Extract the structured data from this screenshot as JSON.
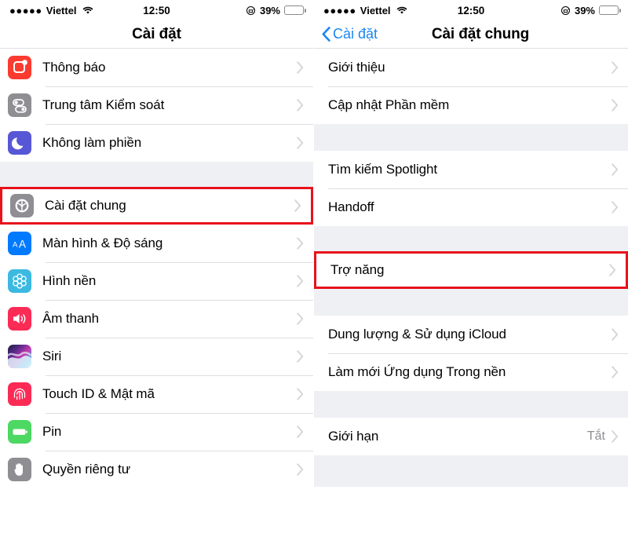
{
  "status_bar": {
    "signal_dots": "●●●●●",
    "carrier": "Viettel",
    "wifi_icon": "wifi-icon",
    "time": "12:50",
    "lock_icon": "rotation-lock-icon",
    "battery_percent": "39%",
    "battery_level": 39,
    "battery_color": "#ffcc00"
  },
  "left_screen": {
    "nav": {
      "title": "Cài đặt"
    },
    "groups": [
      {
        "rows": [
          {
            "label": "Thông báo",
            "icon": "notifications-icon",
            "icon_class": "ic-notify",
            "chevron": true
          },
          {
            "label": "Trung tâm Kiểm soát",
            "icon": "control-center-icon",
            "icon_class": "ic-control",
            "chevron": true
          },
          {
            "label": "Không làm phiền",
            "icon": "do-not-disturb-moon-icon",
            "icon_class": "ic-dnd",
            "chevron": true
          }
        ]
      },
      {
        "rows": [
          {
            "label": "Cài đặt chung",
            "icon": "gear-icon",
            "icon_class": "ic-general",
            "chevron": true,
            "highlighted": true
          },
          {
            "label": "Màn hình & Độ sáng",
            "icon": "display-brightness-icon",
            "icon_class": "ic-display",
            "chevron": true
          },
          {
            "label": "Hình nền",
            "icon": "wallpaper-icon",
            "icon_class": "ic-wallpaper",
            "chevron": true
          },
          {
            "label": "Âm thanh",
            "icon": "sound-speaker-icon",
            "icon_class": "ic-sound",
            "chevron": true
          },
          {
            "label": "Siri",
            "icon": "siri-icon",
            "icon_class": "ic-siri",
            "chevron": true
          },
          {
            "label": "Touch ID & Mật mã",
            "icon": "fingerprint-icon",
            "icon_class": "ic-touchid",
            "chevron": true
          },
          {
            "label": "Pin",
            "icon": "battery-icon",
            "icon_class": "ic-battery",
            "chevron": true
          },
          {
            "label": "Quyền riêng tư",
            "icon": "hand-privacy-icon",
            "icon_class": "ic-privacy",
            "chevron": true
          }
        ]
      }
    ]
  },
  "right_screen": {
    "nav": {
      "back_label": "Cài đặt",
      "back_icon": "chevron-left-icon",
      "title": "Cài đặt chung"
    },
    "groups": [
      {
        "rows": [
          {
            "label": "Giới thiệu",
            "chevron": true
          },
          {
            "label": "Cập nhật Phần mềm",
            "chevron": true
          }
        ]
      },
      {
        "rows": [
          {
            "label": "Tìm kiếm Spotlight",
            "chevron": true
          },
          {
            "label": "Handoff",
            "chevron": true
          }
        ]
      },
      {
        "rows": [
          {
            "label": "Trợ năng",
            "chevron": true,
            "highlighted": true
          }
        ]
      },
      {
        "rows": [
          {
            "label": "Dung lượng & Sử dụng iCloud",
            "chevron": true
          },
          {
            "label": "Làm mới Ứng dụng Trong nền",
            "chevron": true
          }
        ]
      },
      {
        "rows": [
          {
            "label": "Giới hạn",
            "value": "Tắt",
            "chevron": true
          }
        ]
      }
    ]
  },
  "theme": {
    "highlight_color": "#e8121b",
    "accent_blue": "#1a86f0",
    "separator": "#dededf",
    "group_gap_bg": "#eff0f4",
    "value_gray": "#8e8e93"
  }
}
